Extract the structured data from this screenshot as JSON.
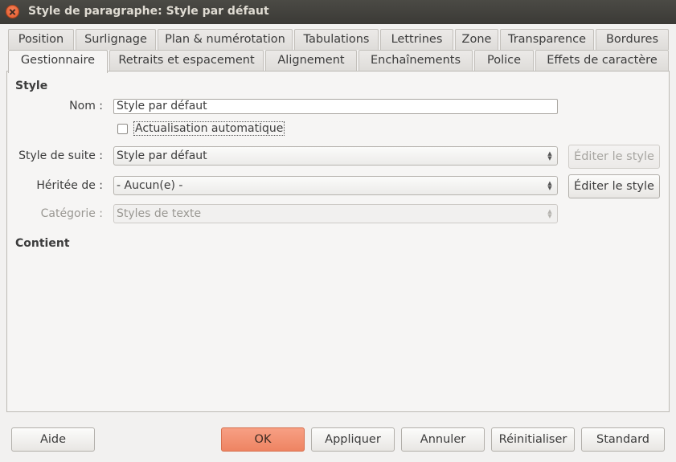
{
  "window": {
    "title": "Style de paragraphe: Style par défaut"
  },
  "tabs_row1": [
    "Position",
    "Surlignage",
    "Plan & numérotation",
    "Tabulations",
    "Lettrines",
    "Zone",
    "Transparence",
    "Bordures"
  ],
  "tabs_row2": [
    "Gestionnaire",
    "Retraits et espacement",
    "Alignement",
    "Enchaînements",
    "Police",
    "Effets de caractère"
  ],
  "active_tab": "Gestionnaire",
  "style_section": {
    "heading": "Style",
    "name_label": "Nom :",
    "name_value": "Style par défaut",
    "autoupdate_label": "Actualisation automatique",
    "autoupdate_checked": false,
    "next_style_label": "Style de suite :",
    "next_style_value": "Style par défaut",
    "edit_style_disabled_label": "Éditer le style",
    "inherit_label": "Héritée de :",
    "inherit_value": "- Aucun(e) -",
    "edit_style_label": "Éditer le style",
    "category_label": "Catégorie :",
    "category_value": "Styles de texte"
  },
  "contains_section": {
    "heading": "Contient"
  },
  "buttons": {
    "help": "Aide",
    "ok": "OK",
    "apply": "Appliquer",
    "cancel": "Annuler",
    "reset": "Réinitialiser",
    "standard": "Standard"
  },
  "colors": {
    "accent": "#f0876a",
    "titlebar": "#3c3b37",
    "background": "#f2f1f0"
  },
  "icons": {
    "close": "close-icon",
    "combo_arrows": "spin-arrows-icon"
  }
}
